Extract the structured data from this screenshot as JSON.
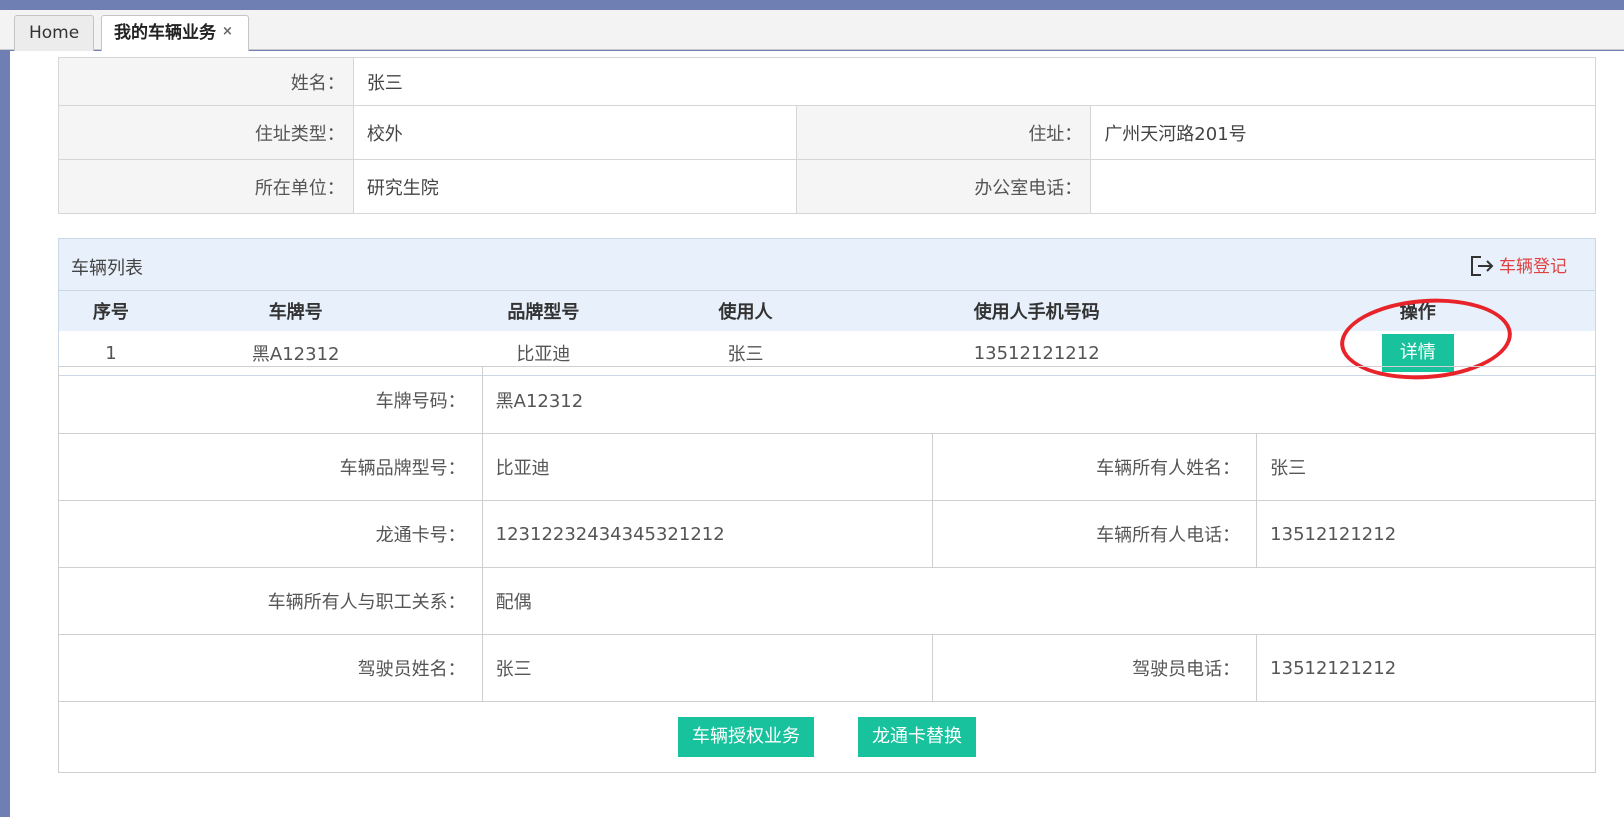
{
  "tabs": [
    {
      "label": "Home",
      "active": false
    },
    {
      "label": "我的车辆业务",
      "active": true,
      "close": "×"
    }
  ],
  "person": {
    "name_label": "姓名：",
    "name": "张三",
    "address_type_label": "住址类型：",
    "address_type": "校外",
    "address_label": "住址：",
    "address": "广州天河路201号",
    "unit_label": "所在单位：",
    "unit": "研究生院",
    "office_phone_label": "办公室电话：",
    "office_phone": ""
  },
  "vehicle_list": {
    "title": "车辆列表",
    "register_label": "车辆登记",
    "columns": [
      "序号",
      "车牌号",
      "品牌型号",
      "使用人",
      "使用人手机号码",
      "操作"
    ],
    "rows": [
      {
        "index": "1",
        "plate": "黑A12312",
        "brand": "比亚迪",
        "user": "张三",
        "phone": "13512121212",
        "action": "详情"
      }
    ]
  },
  "detail": {
    "plate_label": "车牌号码：",
    "plate": "黑A12312",
    "brand_label": "车辆品牌型号：",
    "brand": "比亚迪",
    "owner_name_label": "车辆所有人姓名：",
    "owner_name": "张三",
    "card_label": "龙通卡号：",
    "card": "12312232434345321212",
    "owner_phone_label": "车辆所有人电话：",
    "owner_phone": "13512121212",
    "relation_label": "车辆所有人与职工关系：",
    "relation": "配偶",
    "driver_name_label": "驾驶员姓名：",
    "driver_name": "张三",
    "driver_phone_label": "驾驶员电话：",
    "driver_phone": "13512121212",
    "authorize_button": "车辆授权业务",
    "replace_card_button": "龙通卡替换"
  },
  "colors": {
    "accent_green": "#18c29c",
    "register_red": "#e04141",
    "highlight_red": "#e8242a",
    "header_blue": "#e8f1fb"
  }
}
